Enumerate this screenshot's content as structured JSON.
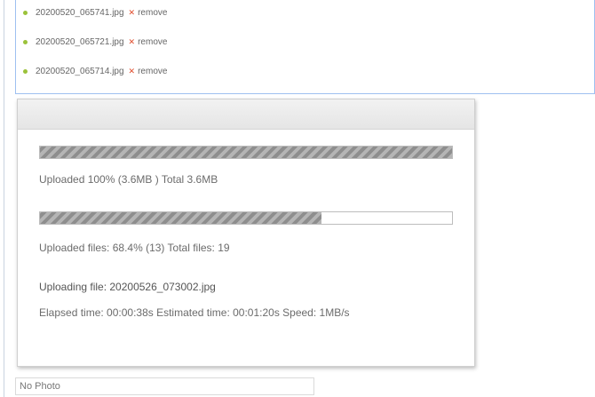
{
  "file_list": [
    {
      "name": "20200520_065741.jpg",
      "remove_label": "remove"
    },
    {
      "name": "20200520_065721.jpg",
      "remove_label": "remove"
    },
    {
      "name": "20200520_065714.jpg",
      "remove_label": "remove"
    }
  ],
  "progress": {
    "bytes_fraction": 1.0,
    "bytes_text": "Uploaded 100% (3.6MB ) Total 3.6MB",
    "files_fraction": 0.684,
    "files_text": "Uploaded files: 68.4% (13) Total files: 19",
    "current_file_text": "Uploading file: 20200526_073002.jpg",
    "time_text": "Elapsed time: 00:00:38s Estimated time: 00:01:20s Speed: 1MB/s"
  },
  "photo_field": {
    "value": "No Photo"
  },
  "colors": {
    "accent_border": "#9ec0f0",
    "bullet": "#9bc23a",
    "remove_x": "#e04a2a",
    "bar_fill": "#8e8e8e"
  }
}
